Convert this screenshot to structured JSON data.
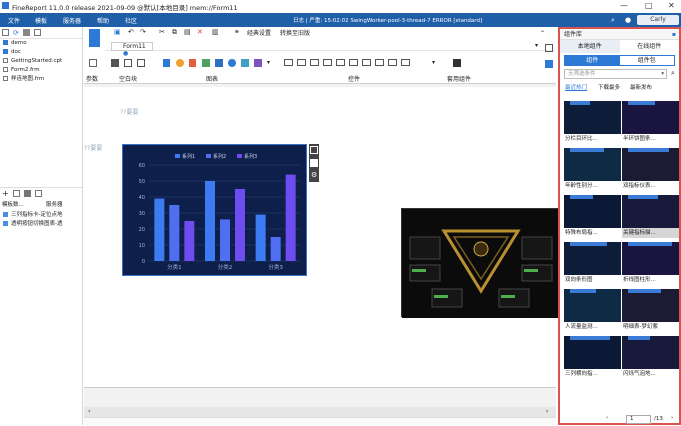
{
  "app": {
    "title": "FineReport 11.0.0 release 2021-09-09 @默认[本地目录]   mem://Form11"
  },
  "menu": [
    "文件",
    "模板",
    "服务器",
    "帮助",
    "社区"
  ],
  "log": {
    "text": "日志 | 严重: 15:02:02 SwingWorker-pool-3-thread-7 ERROR [standard]"
  },
  "user": {
    "name": "Carly"
  },
  "left_files": [
    "demo",
    "doc",
    "GettingStarted.cpt",
    "Form2.frm",
    "样连地图.frm"
  ],
  "left_tabs": [
    "模板数...",
    "服务器"
  ],
  "left_datasets": [
    "三列指标卡-定位点地",
    "透明按钮切换图表-透"
  ],
  "editor": {
    "tab": "Form11",
    "toolbar_labels": {
      "classic": "经典设置",
      "switch": "转换至旧版"
    }
  },
  "ribbon": {
    "groups": [
      "参数",
      "空白块",
      "图表",
      "控件",
      "套用组件"
    ]
  },
  "canvas": {
    "label_top": "??要要",
    "label_left": "??要要"
  },
  "chart_data": {
    "type": "bar",
    "categories": [
      "分类1",
      "分类2",
      "分类3"
    ],
    "series": [
      {
        "name": "系列1",
        "values": [
          39,
          50,
          29
        ]
      },
      {
        "name": "系列2",
        "values": [
          35,
          26,
          15
        ]
      },
      {
        "name": "系列3",
        "values": [
          25,
          45,
          54
        ]
      }
    ],
    "ylim": [
      0,
      60
    ],
    "yticks": [
      0,
      10,
      20,
      30,
      40,
      50,
      60
    ],
    "legend": "top",
    "colors": [
      "#3d7bf2",
      "#4d6ff0",
      "#6e4cf0"
    ]
  },
  "right": {
    "title": "组件库",
    "tabs": [
      "本地组件",
      "在线组件"
    ],
    "subtabs": [
      "组件",
      "组件包"
    ],
    "select_placeholder": "无筛选条件",
    "sort": [
      "最近热门",
      "下载最多",
      "最新发布"
    ],
    "cards": [
      "分栏目环比...",
      "半环饼图条...",
      "年龄性别分...",
      "双指标仪表...",
      "特殊布局指...",
      "关键指标描...",
      "双向条形图",
      "折线图柱形...",
      "人流量监测...",
      "明细表-梦幻紫",
      "三列横向指...",
      "闪烁气泡地..."
    ],
    "pager": {
      "page": "1",
      "total": "/13"
    }
  }
}
